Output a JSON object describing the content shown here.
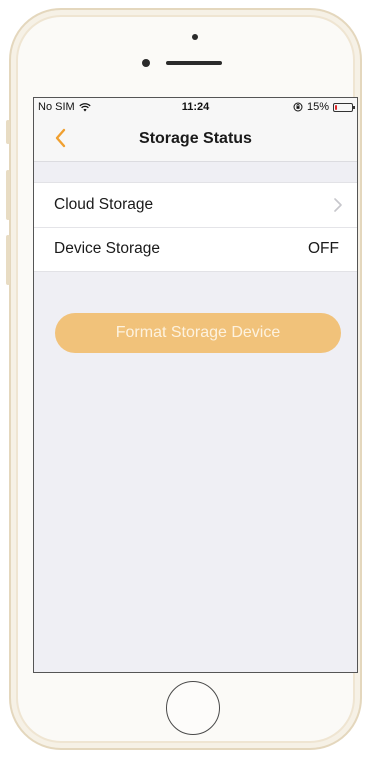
{
  "status_bar": {
    "carrier": "No SIM",
    "time": "11:24",
    "battery_percent": "15%",
    "battery_level": 0.15,
    "wifi_icon": "wifi-icon",
    "battery_color": "#e0282a"
  },
  "nav": {
    "title": "Storage Status",
    "back_icon": "chevron-left-icon",
    "accent_color": "#f0a030"
  },
  "rows": [
    {
      "label": "Cloud Storage",
      "value": "",
      "icon": "chevron-right-icon"
    },
    {
      "label": "Device Storage",
      "value": "OFF"
    }
  ],
  "format_button": {
    "label": "Format Storage Device",
    "color": "#f1c27a"
  }
}
